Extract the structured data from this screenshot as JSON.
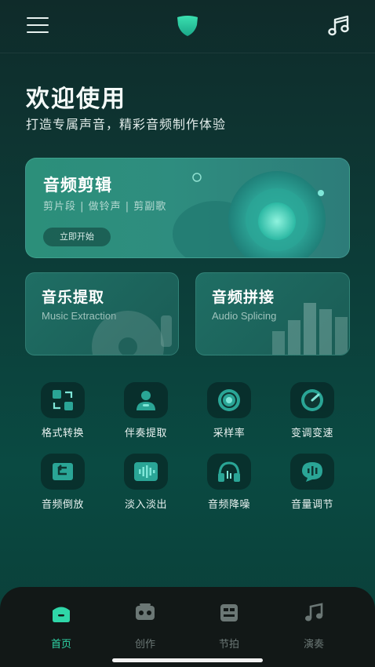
{
  "header": {
    "menu_icon": "hamburger-menu-icon",
    "logo_icon": "shield-logo-icon",
    "music_icon": "music-note-icon"
  },
  "welcome": {
    "title": "欢迎使用",
    "subtitle": "打造专属声音，精彩音频制作体验"
  },
  "hero": {
    "title": "音频剪辑",
    "subtitle": "剪片段 | 做铃声 | 剪副歌",
    "button": "立即开始"
  },
  "cards": [
    {
      "title": "音乐提取",
      "subtitle": "Music Extraction"
    },
    {
      "title": "音频拼接",
      "subtitle": "Audio Splicing"
    }
  ],
  "tools": [
    {
      "label": "格式转换",
      "icon": "format-convert-icon"
    },
    {
      "label": "伴奏提取",
      "icon": "accompaniment-icon"
    },
    {
      "label": "采样率",
      "icon": "sample-rate-icon"
    },
    {
      "label": "变调变速",
      "icon": "pitch-speed-icon"
    },
    {
      "label": "音频倒放",
      "icon": "reverse-icon"
    },
    {
      "label": "淡入淡出",
      "icon": "fade-icon"
    },
    {
      "label": "音频降噪",
      "icon": "noise-reduction-icon"
    },
    {
      "label": "音量调节",
      "icon": "volume-icon"
    }
  ],
  "tabbar": {
    "tabs": [
      {
        "label": "首页",
        "icon": "home-icon",
        "active": true
      },
      {
        "label": "创作",
        "icon": "create-icon",
        "active": false
      },
      {
        "label": "节拍",
        "icon": "beat-icon",
        "active": false
      },
      {
        "label": "演奏",
        "icon": "play-music-icon",
        "active": false
      }
    ]
  },
  "colors": {
    "accent": "#2fd6a8",
    "background": "#0c3f3a",
    "tabbar": "#121817"
  }
}
